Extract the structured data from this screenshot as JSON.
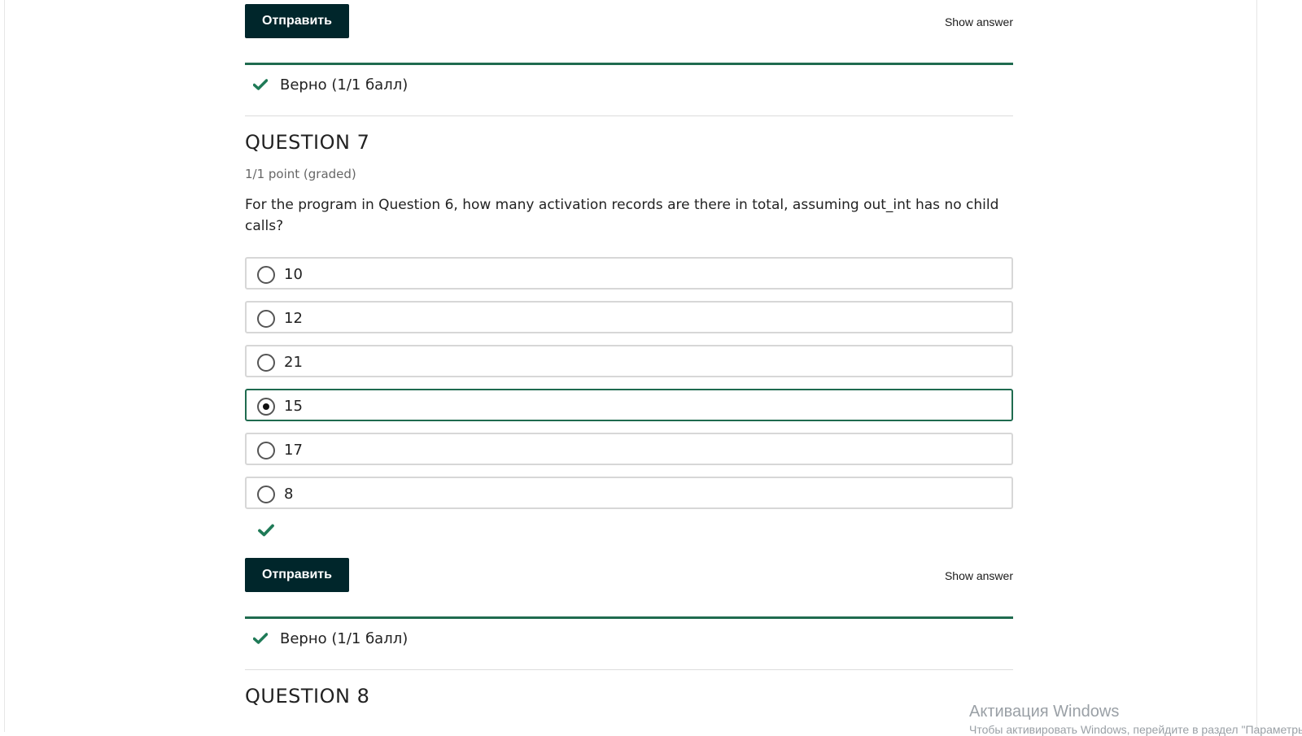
{
  "top_actions": {
    "submit_label": "Отправить",
    "show_answer_label": "Show answer"
  },
  "top_feedback": {
    "text": "Верно (1/1 балл)"
  },
  "question7": {
    "title": "QUESTION 7",
    "points": "1/1 point (graded)",
    "prompt": "For the program in Question 6, how many activation records are there in total, assuming out_int has no child calls?",
    "options": [
      {
        "label": "10",
        "selected": false
      },
      {
        "label": "12",
        "selected": false
      },
      {
        "label": "21",
        "selected": false
      },
      {
        "label": "15",
        "selected": true
      },
      {
        "label": "17",
        "selected": false
      },
      {
        "label": "8",
        "selected": false
      }
    ],
    "submit_label": "Отправить",
    "show_answer_label": "Show answer",
    "feedback_text": "Верно (1/1 балл)"
  },
  "question8": {
    "title": "QUESTION 8"
  },
  "watermark": {
    "line1": "Активация Windows",
    "line2": "Чтобы активировать Windows, перейдите в раздел \"Параметры\"."
  },
  "colors": {
    "accent": "#1f6b4f",
    "button": "#00262b"
  },
  "icons": {
    "check": "check-icon",
    "radio": "radio-icon"
  }
}
